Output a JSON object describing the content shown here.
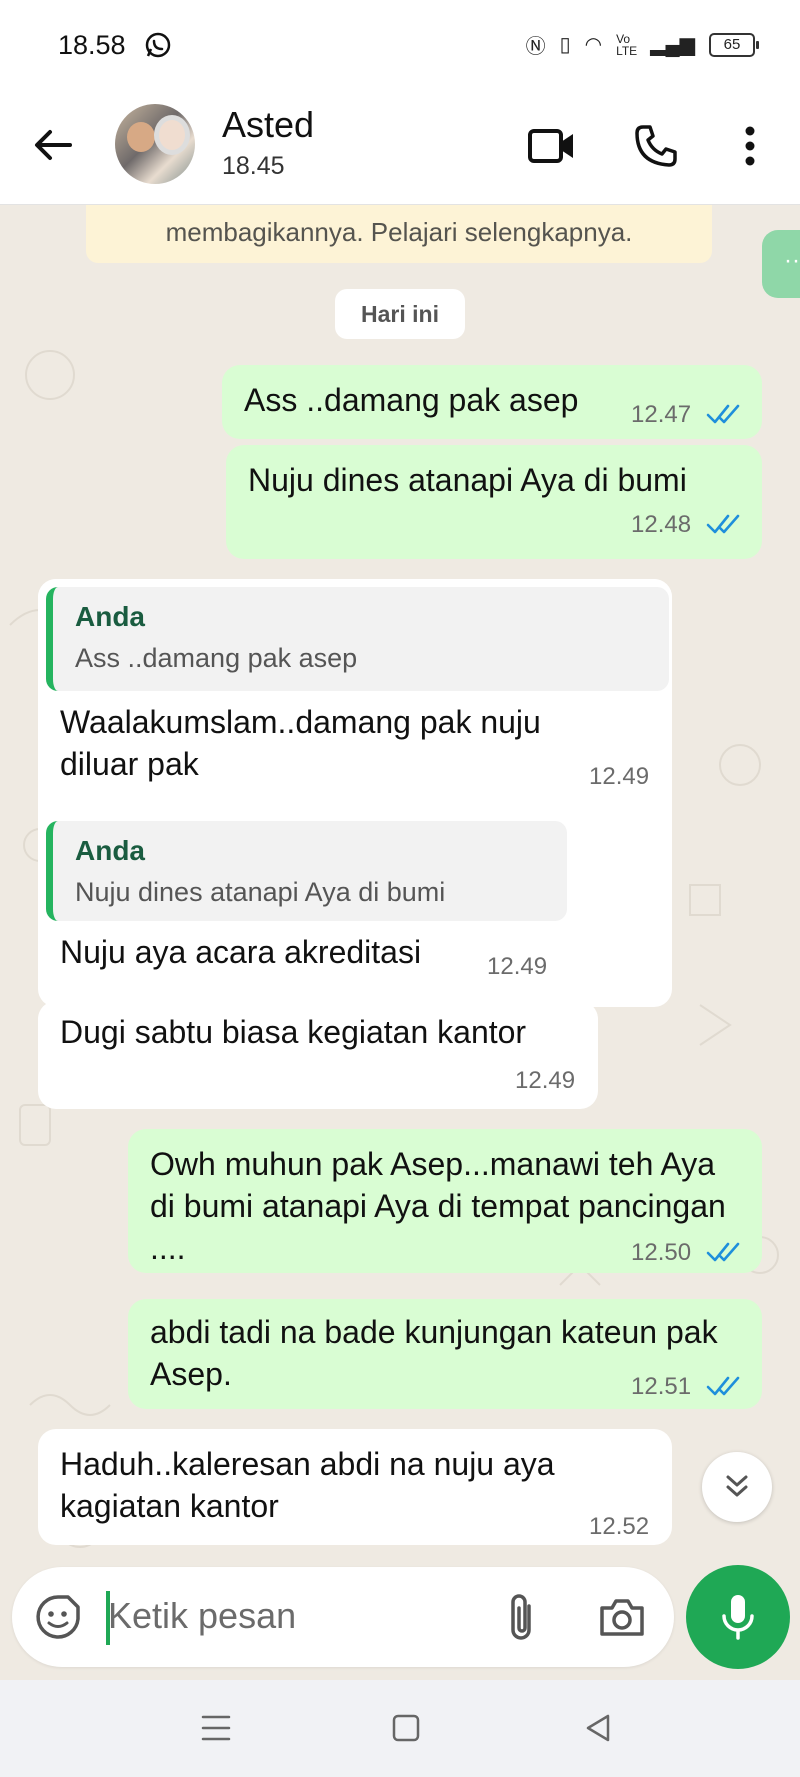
{
  "status_bar": {
    "time": "18.58",
    "battery": "65",
    "volte": "Vo LTE"
  },
  "chat_header": {
    "contact_name": "Asted",
    "contact_status": "18.45"
  },
  "security_notice": {
    "text": "membagikannya. Pelajari selengkapnya."
  },
  "date_chip": {
    "label": "Hari ini"
  },
  "messages": [
    {
      "direction": "out",
      "text": "Ass ..damang pak asep",
      "time": "12.47",
      "status": "read"
    },
    {
      "direction": "out",
      "text": "Nuju dines atanapi Aya di bumi",
      "time": "12.48",
      "status": "read"
    },
    {
      "direction": "in",
      "quote": {
        "author": "Anda",
        "text": "Ass ..damang pak asep"
      },
      "text": "Waalakumslam..damang pak nuju diluar pak",
      "time": "12.49"
    },
    {
      "direction": "in",
      "quote": {
        "author": "Anda",
        "text": "Nuju dines atanapi Aya di bumi"
      },
      "text": "Nuju aya acara akreditasi",
      "time": "12.49"
    },
    {
      "direction": "in",
      "text": "Dugi sabtu biasa kegiatan kantor",
      "time": "12.49"
    },
    {
      "direction": "out",
      "text": "Owh muhun pak Asep...manawi teh Aya di bumi atanapi Aya di tempat pancingan ....",
      "time": "12.50",
      "status": "read"
    },
    {
      "direction": "out",
      "text": "abdi tadi na bade kunjungan kateun pak Asep.",
      "time": "12.51",
      "status": "read"
    },
    {
      "direction": "in",
      "text": "Haduh..kaleresan abdi na nuju aya kagiatan kantor",
      "time": "12.52"
    }
  ],
  "composer": {
    "placeholder": "Ketik pesan"
  },
  "colors": {
    "outgoing_bubble": "#d9fdd3",
    "incoming_bubble": "#ffffff",
    "accent_green": "#1fa855",
    "read_ticks": "#1f8fdb",
    "chat_bg": "#efeae2"
  }
}
